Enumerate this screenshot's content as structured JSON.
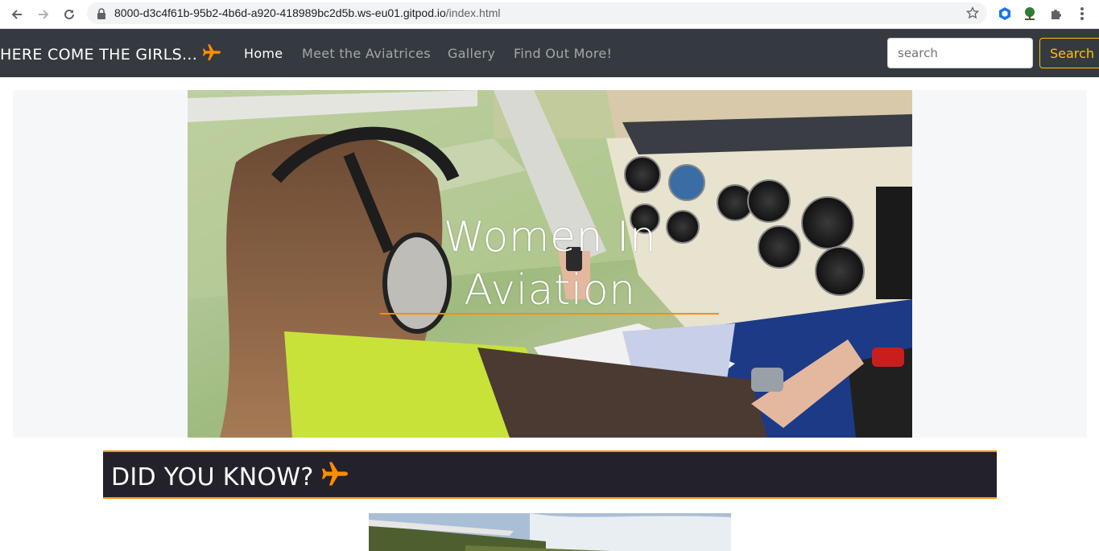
{
  "browser": {
    "url_host": "8000-d3c4f61b-95b2-4b6d-a920-418989bc2d5b.ws-eu01.gitpod.io",
    "url_path": "/index.html"
  },
  "navbar": {
    "brand": "HERE COME THE GIRLS...",
    "links": [
      "Home",
      "Meet the Aviatrices",
      "Gallery",
      "Find Out More!"
    ],
    "active_link": "Home",
    "search_placeholder": "search",
    "search_button": "Search"
  },
  "hero": {
    "title_line1": "Women In",
    "title_line2": "Aviation"
  },
  "did_you_know": {
    "heading": "DID YOU KNOW?"
  },
  "colors": {
    "navbar_bg": "#343a40",
    "accent_orange": "#ff8c00",
    "search_yellow": "#ffc107",
    "banner_bg": "#23222b"
  }
}
